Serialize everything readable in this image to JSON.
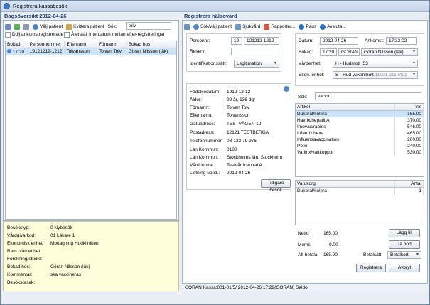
{
  "window": {
    "title": "Registrera kassabesök"
  },
  "left": {
    "heading": "Dagsöversikt 2012-04-26",
    "toolbar": {
      "select_patient": "Välj patient",
      "receipt_patient": "Kvittera patient",
      "search_label": "Sök:",
      "search_value": "tolv"
    },
    "checks": {
      "hide_prereg": "Dölj ankomstregistrerade",
      "show_other_dates": "Återställ inte datum mellan efter-registreringar"
    },
    "columns": [
      "Bokad",
      "Personnummer",
      "Efternamn",
      "Förnamn",
      "Bokad hos"
    ],
    "rows": [
      [
        "17:20",
        "19121212-1212",
        "Tolvansson",
        "Tolvan Tolv",
        "Göran Nilsson (läk)"
      ]
    ]
  },
  "info": {
    "labels": [
      "Besökstyp:",
      "Vårdgivarkod:",
      "Ekonomisk enhet:",
      "Rem. vårdenhet:",
      "Forskning/studie:",
      "Bokad hos:",
      "Kommentar:",
      "Besöksorsak:"
    ],
    "values": [
      "0  Nybesök",
      "01 Läkare 1",
      "Mottagning Hudkliniken",
      "",
      "",
      "Göran Nilsson (läk)",
      "ska vaccineras",
      ""
    ]
  },
  "right": {
    "heading": "Registrera hälsovård",
    "toolbar": {
      "search_patient": "Sök/välj patient",
      "sick_visit": "Sjukvård",
      "reports": "Rapporter...",
      "pause": "Paus",
      "exit": "Avsluta..."
    },
    "patient": {
      "pnr_label": "Personnr:",
      "pnr_century": "19",
      "pnr_value": "121212-1212",
      "reserve_label": "Reserv:",
      "id_label": "Identifikationssätt:",
      "id_value": "Legitimation"
    },
    "visit": {
      "date_label": "Datum:",
      "date_value": "2012-04-26",
      "arrival_label": "Ankomst:",
      "arrival_value": "17:32:02",
      "booked_label": "Bokad:",
      "booked_time": "17:20",
      "booked_sign": "GORAN",
      "booked_name": "Göran Nilsson (läk)",
      "unit_label": "Vårdenhet:",
      "unit_value": "H - Hudmott I53",
      "econ_label": "Ekon. enhet:",
      "econ_value": "S - Hud vuxenmott",
      "econ_code": "11001-211-I401"
    },
    "details": {
      "labels": [
        "Födelsedatum:",
        "Ålder:",
        "Förnamn:",
        "Efternamn:",
        "Gatuadress:",
        "Postadress:",
        "Telefonnummer:",
        "Län Kommun:",
        "Län Kommun:",
        "Vårdcentral:",
        "Listning uppd.:"
      ],
      "values": [
        "1912-12-12",
        "99 år, 136 dgr",
        "Tolvan Tolv",
        "Tolvansson",
        "TESTVÄGEN 12",
        "12121      TESTBERGA",
        "08-123 79 976",
        "0180",
        "Stockholms län, Stockholm",
        "Testvårdcentral A",
        "2012-04-26"
      ],
      "history_btn": "Tidigare besök"
    },
    "articles": {
      "search_label": "Sök:",
      "search_value": "vaccin",
      "col_article": "Artikel",
      "col_price": "Pris",
      "items": [
        [
          "Dukoral/kolera",
          "165.00"
        ],
        [
          "Havrix/hepatit A",
          "370.00"
        ],
        [
          "Imovax/rabies",
          "546.00"
        ],
        [
          "Infanrix hexa",
          "465.00"
        ],
        [
          "Influensavaccination",
          "200.00"
        ],
        [
          "Polio",
          "240.00"
        ],
        [
          "Varilrix/vattkoppor",
          "530.00"
        ]
      ]
    },
    "cart": {
      "col_cart": "Varukorg",
      "col_qty": "Antal",
      "items": [
        [
          "Dukoral/kolera",
          "1"
        ]
      ]
    },
    "totals": {
      "net_label": "Netto",
      "net_value": "165.00",
      "vat_label": "Moms",
      "vat_value": "0.00",
      "pay_label": "Att betala",
      "pay_value": "165.00",
      "method_label": "Betalsätt",
      "method_value": "Betalkort"
    },
    "buttons": {
      "add": "Lägg till",
      "remove": "Ta bort",
      "register": "Registrera",
      "cancel": "Avbryt"
    }
  },
  "statusbar": {
    "text": "GORAN  Kassa:001-01/5/  2012-04-26 17:29(GORAN)  Saldo:"
  },
  "colors": {
    "selected_row": "#cde3f8",
    "info_bg": "#fefedb"
  }
}
